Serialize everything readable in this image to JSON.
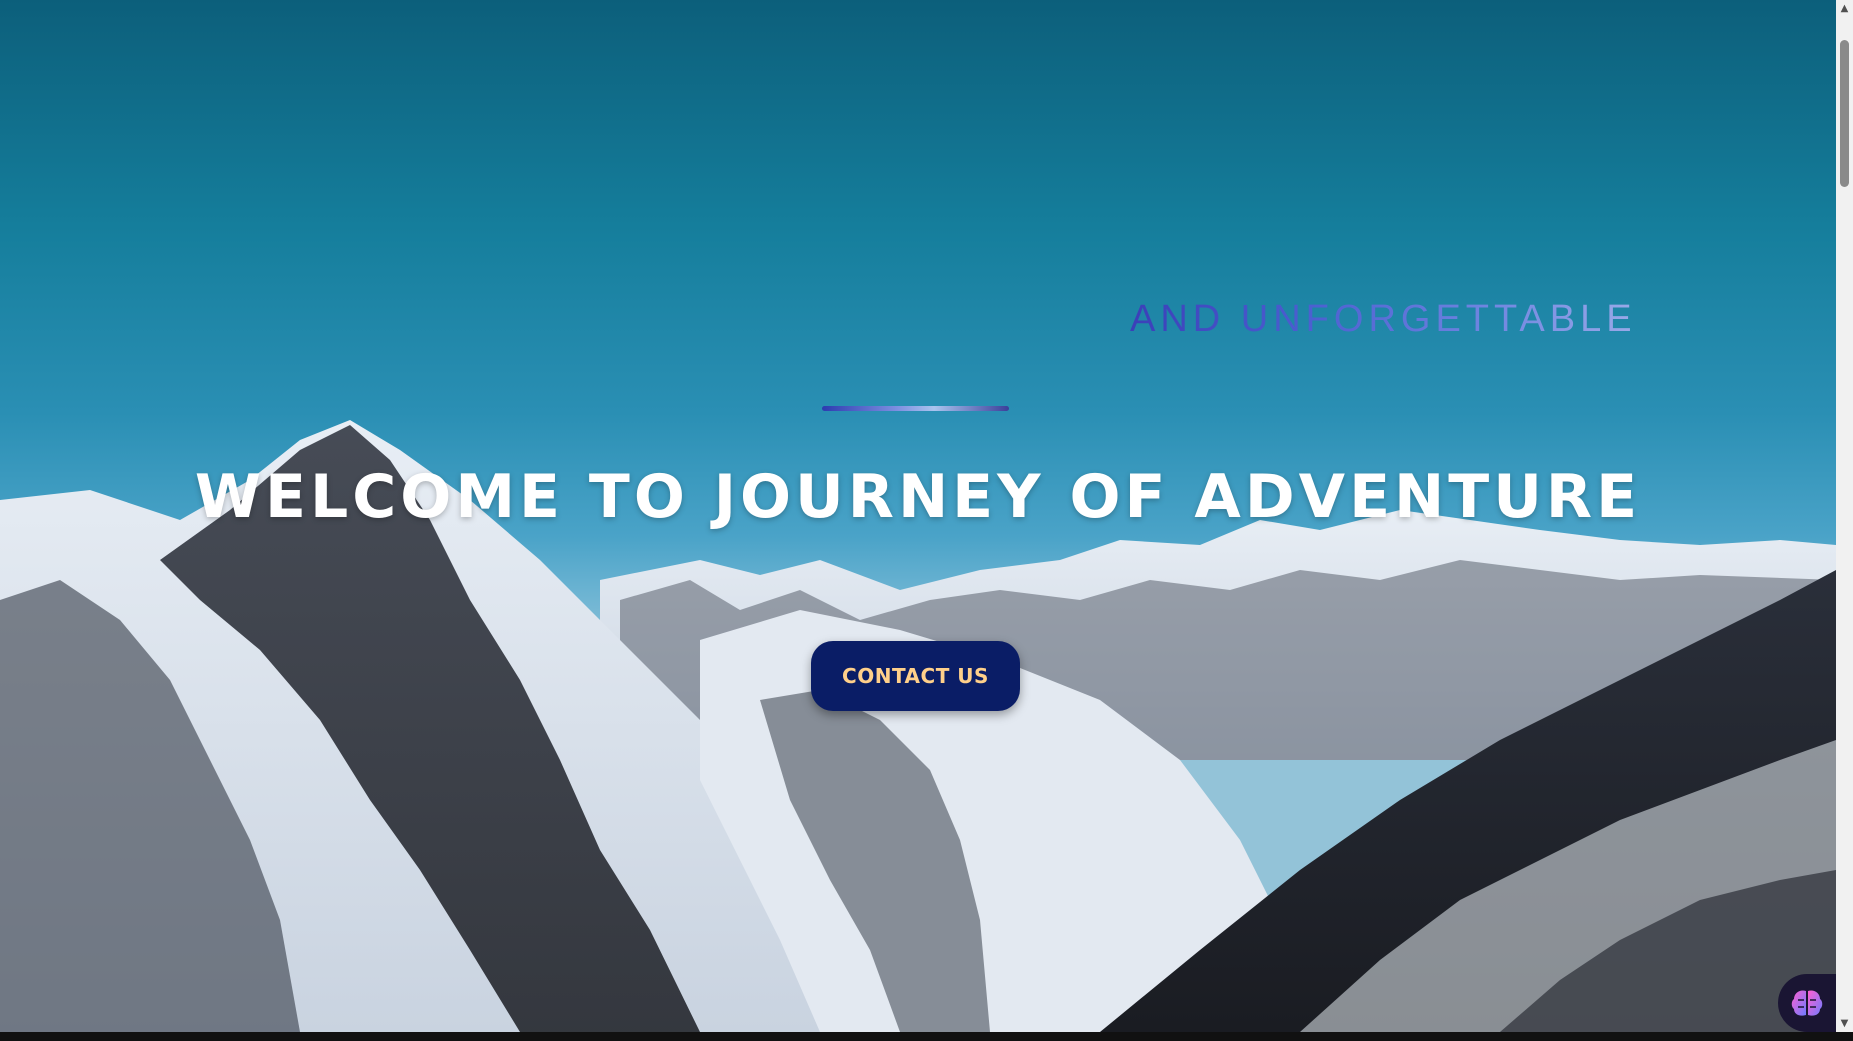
{
  "hero": {
    "tagline": "AND UNFORGETTABLE",
    "headline": "WELCOME TO JOURNEY OF ADVENTURE",
    "cta_label": "CONTACT US"
  },
  "widget": {
    "icon": "brain-icon"
  },
  "scrollbar": {
    "up_icon": "▲",
    "down_icon": "▼"
  },
  "colors": {
    "cta_background": "#0a1d66",
    "cta_text": "#ffd08a",
    "tagline": "#4f62c8"
  }
}
